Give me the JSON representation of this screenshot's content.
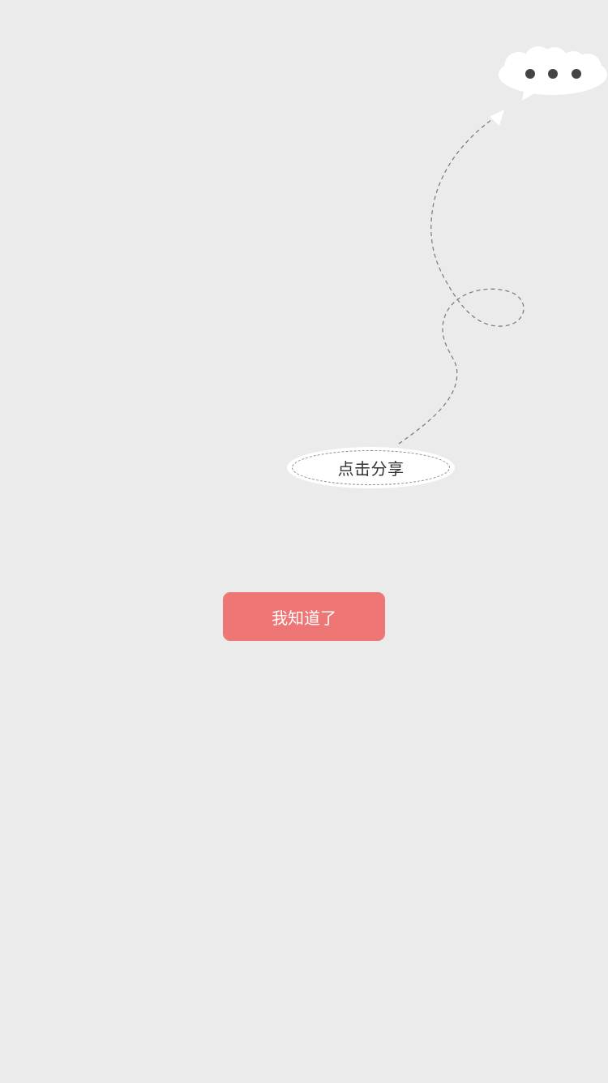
{
  "guide": {
    "menu_icon": "more-dots-icon",
    "share_hint": "点击分享",
    "confirm_label": "我知道了"
  },
  "colors": {
    "background": "#ebebeb",
    "button": "#ee7674",
    "button_text": "#ffffff",
    "dots": "#444444",
    "dashed_line": "#777777"
  }
}
